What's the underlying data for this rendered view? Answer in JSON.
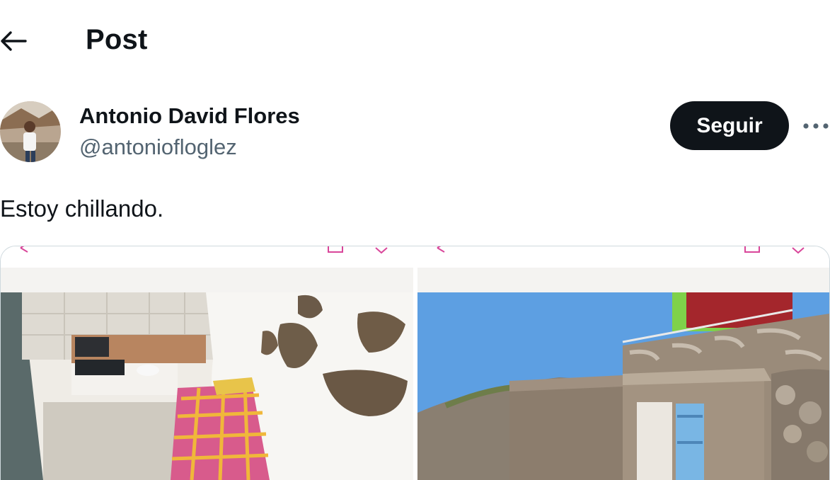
{
  "header": {
    "title": "Post",
    "back_icon": "arrow-left-icon"
  },
  "author": {
    "display_name": "Antonio David Flores",
    "handle": "@antoniofloglez"
  },
  "actions": {
    "follow_label": "Seguir",
    "more_icon": "more-horizontal-icon"
  },
  "post": {
    "text": "Estoy chillando."
  },
  "media": [
    {
      "type": "photo",
      "subject": "cave-room-interior"
    },
    {
      "type": "photo",
      "subject": "stone-house-exterior"
    }
  ],
  "colors": {
    "text_primary": "#0f1419",
    "text_secondary": "#536471",
    "follow_button_bg": "#0f1419",
    "border": "#cfd9de"
  }
}
